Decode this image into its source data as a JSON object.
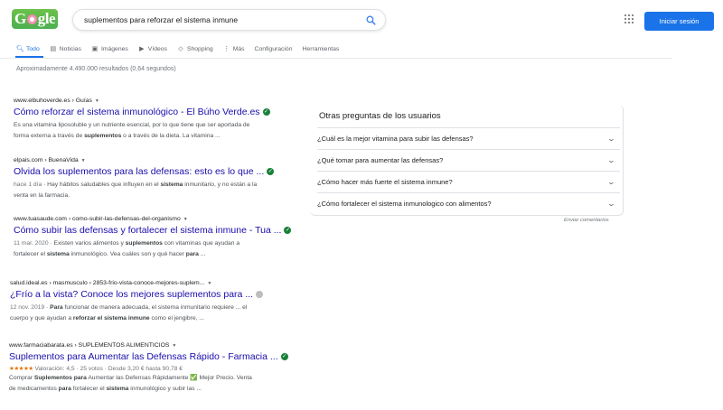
{
  "header": {
    "logo_text": "Google",
    "search_value": "suplementos para reforzar el sistema inmune",
    "signin_label": "Iniciar sesión"
  },
  "tabs": [
    {
      "icon": "search-icon",
      "label": "Todo"
    },
    {
      "icon": "news-icon",
      "label": "Noticias"
    },
    {
      "icon": "images-icon",
      "label": "Imágenes"
    },
    {
      "icon": "video-icon",
      "label": "Vídeos"
    },
    {
      "icon": "shopping-icon",
      "label": "Shopping"
    },
    {
      "icon": "more-icon",
      "label": "Más"
    },
    {
      "icon": "",
      "label": "Configuración"
    },
    {
      "icon": "",
      "label": "Herramientas"
    }
  ],
  "stats": "Aproximadamente 4.490.000 resultados (0,64 segundos)",
  "results": [
    {
      "url": "www.elbuhoverde.es › Guías",
      "title": "Cómo reforzar el sistema inmunológico - El Búho Verde.es",
      "verified": "green",
      "snippet1": "Es una vitamina liposoluble y un nutriente esencial, por lo que tiene que ser aportada de",
      "snippet2_pre": "forma externa a través de ",
      "snippet2_b": "suplementos",
      "snippet2_post": " o a través de la dieta. La vitamina ..."
    },
    {
      "url": "elpais.com › BuenaVida",
      "title": "Olvida los suplementos para las defensas: esto es lo que ...",
      "verified": "green",
      "date": "hace 1 día",
      "snippet1_post": " · Hay hábitos saludables que influyen en el ",
      "snippet1_b": "sistema",
      "snippet1_end": " inmunitario, y no están a la",
      "snippet2": "venta en la farmacia."
    },
    {
      "url": "www.tuasaude.com › como-subir-las-defensas-del-organismo",
      "title": "Cómo subir las defensas y fortalecer el sistema inmune - Tua ...",
      "verified": "green",
      "date": "11 mar. 2020",
      "s1a": " · Existen varios alimentos y ",
      "s1b": "suplementos",
      "s1c": " con vitaminas que ayudan a",
      "s2a": "fortalecer el ",
      "s2b": "sistema",
      "s2c": " inmunológico. Vea cuáles son y qué hacer ",
      "s2d": "para",
      "s2e": " ..."
    },
    {
      "url": "salud.ideal.es › masmusculo › 2853-frio-vista-conoce-mejores-suplem...",
      "title": "¿Frío a la vista? Conoce los mejores suplementos para ...",
      "verified": "grey",
      "date": "12 nov. 2019",
      "s1a": " · ",
      "s1b": "Para",
      "s1c": " funcionar de manera adecuada, el sistema inmunitario requiere ... el",
      "s2a": "cuerpo y que ayudan a ",
      "s2b": "reforzar el sistema inmune",
      "s2c": " como el jengibre, ..."
    },
    {
      "url": "www.farmaciabarata.es › SUPLEMENTOS ALIMENTICIOS",
      "title": "Suplementos para Aumentar las Defensas Rápido - Farmacia ...",
      "verified": "green",
      "stars": "★★★★★",
      "rating": "Valoración: 4,5 · 25 votos · Desde 3,20 € hasta 90,78 €",
      "s1a": "Comprar ",
      "s1b": "Suplementos para",
      "s1c": " Aumentar las Defensas Rápidamente ✅ Mejor Precio. Venta",
      "s2a": "de medicamentos ",
      "s2b": "para",
      "s2c": " fortalecer el ",
      "s2d": "sistema",
      "s2e": " inmunológico y subir las ..."
    }
  ],
  "related": {
    "title": "Otras preguntas de los usuarios",
    "questions": [
      "¿Cuál es la mejor vitamina para subir las defensas?",
      "¿Qué tomar para aumentar las defensas?",
      "¿Cómo hacer más fuerte el sistema inmune?",
      "¿Cómo fortalecer el sistema inmunologico con alimentos?"
    ],
    "feedback": "Enviar comentarios"
  }
}
